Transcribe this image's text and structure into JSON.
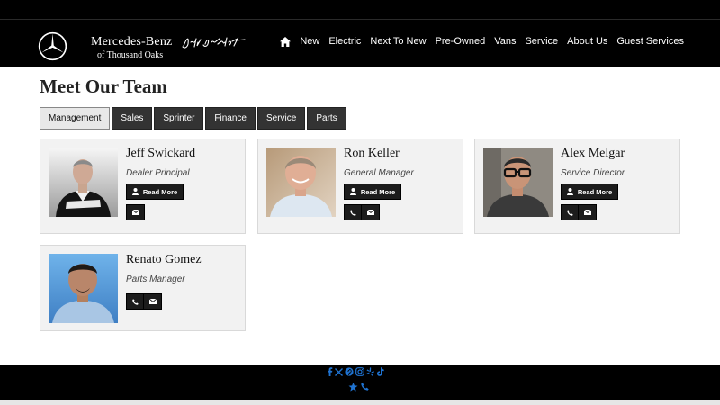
{
  "brand": {
    "name": "Mercedes-Benz",
    "location": "of Thousand Oaks",
    "signature": "Jeff Swick"
  },
  "nav": [
    "New",
    "Electric",
    "Next To New",
    "Pre-Owned",
    "Vans",
    "Service",
    "About Us",
    "Guest Services"
  ],
  "page": {
    "title": "Meet Our Team"
  },
  "tabs": [
    "Management",
    "Sales",
    "Sprinter",
    "Finance",
    "Service",
    "Parts"
  ],
  "active_tab": "Management",
  "buttons": {
    "read_more": "Read More"
  },
  "team": [
    {
      "name": "Jeff Swickard",
      "role": "Dealer Principal",
      "has_read_more": true,
      "has_phone": false,
      "has_email": true
    },
    {
      "name": "Ron Keller",
      "role": "General Manager",
      "has_read_more": true,
      "has_phone": true,
      "has_email": true
    },
    {
      "name": "Alex Melgar",
      "role": "Service Director",
      "has_read_more": true,
      "has_phone": true,
      "has_email": true
    },
    {
      "name": "Renato Gomez",
      "role": "Parts Manager",
      "has_read_more": false,
      "has_phone": true,
      "has_email": true
    }
  ],
  "footer": {
    "social": [
      "facebook-icon",
      "x-icon",
      "pinterest-icon",
      "instagram-icon",
      "yelp-icon",
      "tiktok-icon"
    ],
    "extras": [
      "star-icon",
      "phone-icon"
    ]
  },
  "colors": {
    "header_bg": "#000000",
    "social_blue": "#1f73d1",
    "card_bg": "#f2f2f2",
    "button_bg": "#1c1c1c"
  }
}
